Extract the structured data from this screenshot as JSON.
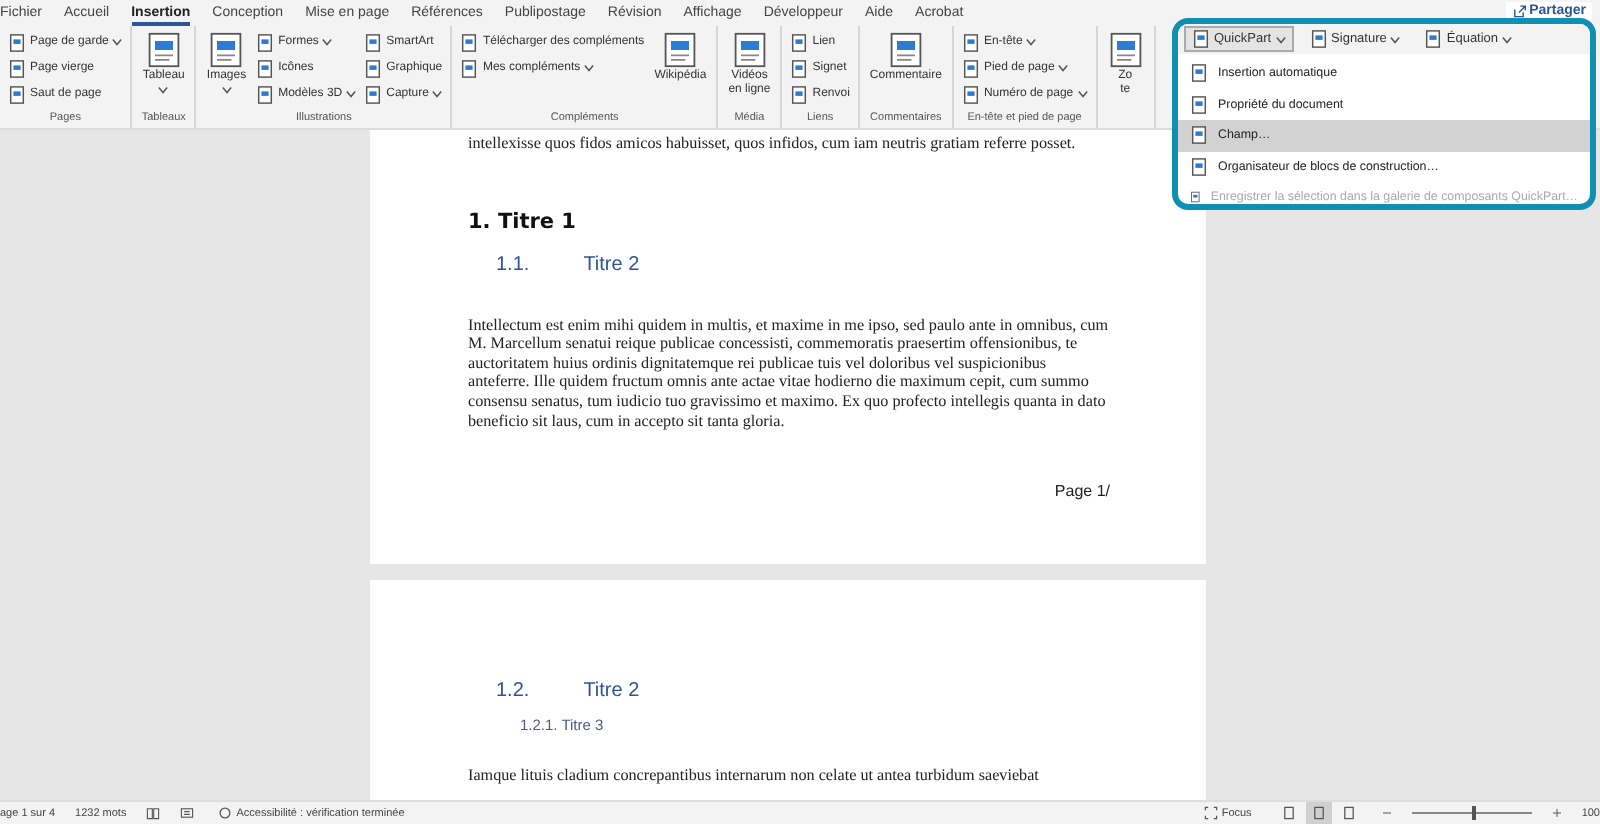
{
  "tabs": [
    {
      "label": "Fichier",
      "selected": false
    },
    {
      "label": "Accueil",
      "selected": false
    },
    {
      "label": "Insertion",
      "selected": true
    },
    {
      "label": "Conception",
      "selected": false
    },
    {
      "label": "Mise en page",
      "selected": false
    },
    {
      "label": "Références",
      "selected": false
    },
    {
      "label": "Publipostage",
      "selected": false
    },
    {
      "label": "Révision",
      "selected": false
    },
    {
      "label": "Affichage",
      "selected": false
    },
    {
      "label": "Développeur",
      "selected": false
    },
    {
      "label": "Aide",
      "selected": false
    },
    {
      "label": "Acrobat",
      "selected": false
    }
  ],
  "share_button": {
    "label": "Partager"
  },
  "ribbon": {
    "groups": [
      {
        "label": "Pages",
        "columns": [
          {
            "kind": "stack",
            "items": [
              {
                "label": "Page de garde",
                "dropdown": true
              },
              {
                "label": "Page vierge",
                "dropdown": false
              },
              {
                "label": "Saut de page",
                "dropdown": false
              }
            ]
          }
        ]
      },
      {
        "label": "Tableaux",
        "columns": [
          {
            "kind": "large",
            "lines": [
              "Tableau"
            ],
            "dropdown": true
          }
        ]
      },
      {
        "label": "Illustrations",
        "columns": [
          {
            "kind": "large",
            "lines": [
              "Images"
            ],
            "dropdown": true
          },
          {
            "kind": "stack",
            "items": [
              {
                "label": "Formes",
                "dropdown": true
              },
              {
                "label": "Icônes",
                "dropdown": false
              },
              {
                "label": "Modèles 3D",
                "dropdown": true
              }
            ]
          },
          {
            "kind": "stack",
            "items": [
              {
                "label": "SmartArt",
                "dropdown": false
              },
              {
                "label": "Graphique",
                "dropdown": false
              },
              {
                "label": "Capture",
                "dropdown": true
              }
            ]
          }
        ]
      },
      {
        "label": "Compléments",
        "columns": [
          {
            "kind": "stack",
            "items": [
              {
                "label": "Télécharger des compléments",
                "dropdown": false
              },
              {
                "label": "Mes compléments",
                "dropdown": true
              }
            ]
          },
          {
            "kind": "large",
            "lines": [
              "Wikipédia"
            ],
            "dropdown": false
          }
        ]
      },
      {
        "label": "Média",
        "columns": [
          {
            "kind": "large",
            "lines": [
              "Vidéos",
              "en ligne"
            ],
            "dropdown": false
          }
        ]
      },
      {
        "label": "Liens",
        "columns": [
          {
            "kind": "stack",
            "items": [
              {
                "label": "Lien",
                "dropdown": false
              },
              {
                "label": "Signet",
                "dropdown": false
              },
              {
                "label": "Renvoi",
                "dropdown": false
              }
            ]
          }
        ]
      },
      {
        "label": "Commentaires",
        "columns": [
          {
            "kind": "large",
            "lines": [
              "Commentaire"
            ],
            "dropdown": false
          }
        ]
      },
      {
        "label": "En-tête et pied de page",
        "columns": [
          {
            "kind": "stack",
            "items": [
              {
                "label": "En-tête",
                "dropdown": true
              },
              {
                "label": "Pied de page",
                "dropdown": true
              },
              {
                "label": "Numéro de page",
                "dropdown": true
              }
            ]
          }
        ]
      },
      {
        "columns": [
          {
            "kind": "large",
            "lines": [
              "Zo",
              "te"
            ],
            "dropdown": false
          }
        ]
      }
    ]
  },
  "quickpart_panel": {
    "buttons": [
      {
        "label": "QuickPart",
        "selected": true
      },
      {
        "label": "Signature",
        "selected": false
      },
      {
        "label": "Équation",
        "selected": false
      }
    ],
    "menu": [
      {
        "label": "Insertion automatique",
        "selected": false,
        "disabled": false
      },
      {
        "label": "Propriété du document",
        "selected": false,
        "disabled": false
      },
      {
        "label": "Champ…",
        "selected": true,
        "disabled": false
      },
      {
        "label": "Organisateur de blocs de construction…",
        "selected": false,
        "disabled": false
      },
      {
        "label": "Enregistrer la sélection dans la galerie de composants QuickPart…",
        "selected": false,
        "disabled": true
      }
    ]
  },
  "pages": [
    {
      "blocks": [
        {
          "kind": "body",
          "text": "intellexisse quos fidos amicos habuisset, quos infidos, cum iam neutris gratiam referre posset."
        },
        {
          "kind": "heading1",
          "text": "1. Titre 1"
        },
        {
          "kind": "heading2",
          "number": "1.1.",
          "text": "Titre 2"
        },
        {
          "kind": "body",
          "text": "Intellectum est enim mihi quidem in multis, et maxime in me ipso, sed paulo ante in omnibus, cum M. Marcellum senatui reique publicae concessisti, commemoratis praesertim offensionibus, te auctoritatem huius ordinis dignitatemque rei publicae tuis vel doloribus vel suspicionibus anteferre. Ille quidem fructum omnis ante actae vitae hodierno die maximum cepit, cum summo consensu senatus, tum iudicio tuo gravissimo et maximo. Ex quo profecto intellegis quanta in dato beneficio sit laus, cum in accepto sit tanta gloria."
        },
        {
          "kind": "footer",
          "text": "Page 1/"
        }
      ]
    },
    {
      "blocks": [
        {
          "kind": "heading2",
          "number": "1.2.",
          "text": "Titre 2"
        },
        {
          "kind": "heading3",
          "text": "1.2.1. Titre 3"
        },
        {
          "kind": "body",
          "text": "Iamque lituis cladium concrepantibus internarum non celate ut antea turbidum saeviebat"
        }
      ]
    }
  ],
  "status_bar": {
    "page": "age 1 sur 4",
    "words": "1232 mots",
    "accessibility": "Accessibilité : vérification terminée",
    "focus": "Focus",
    "views": [
      {
        "selected": false
      },
      {
        "selected": true
      },
      {
        "selected": false
      }
    ],
    "zoom": {
      "level": 0.5,
      "reading": "100"
    }
  }
}
